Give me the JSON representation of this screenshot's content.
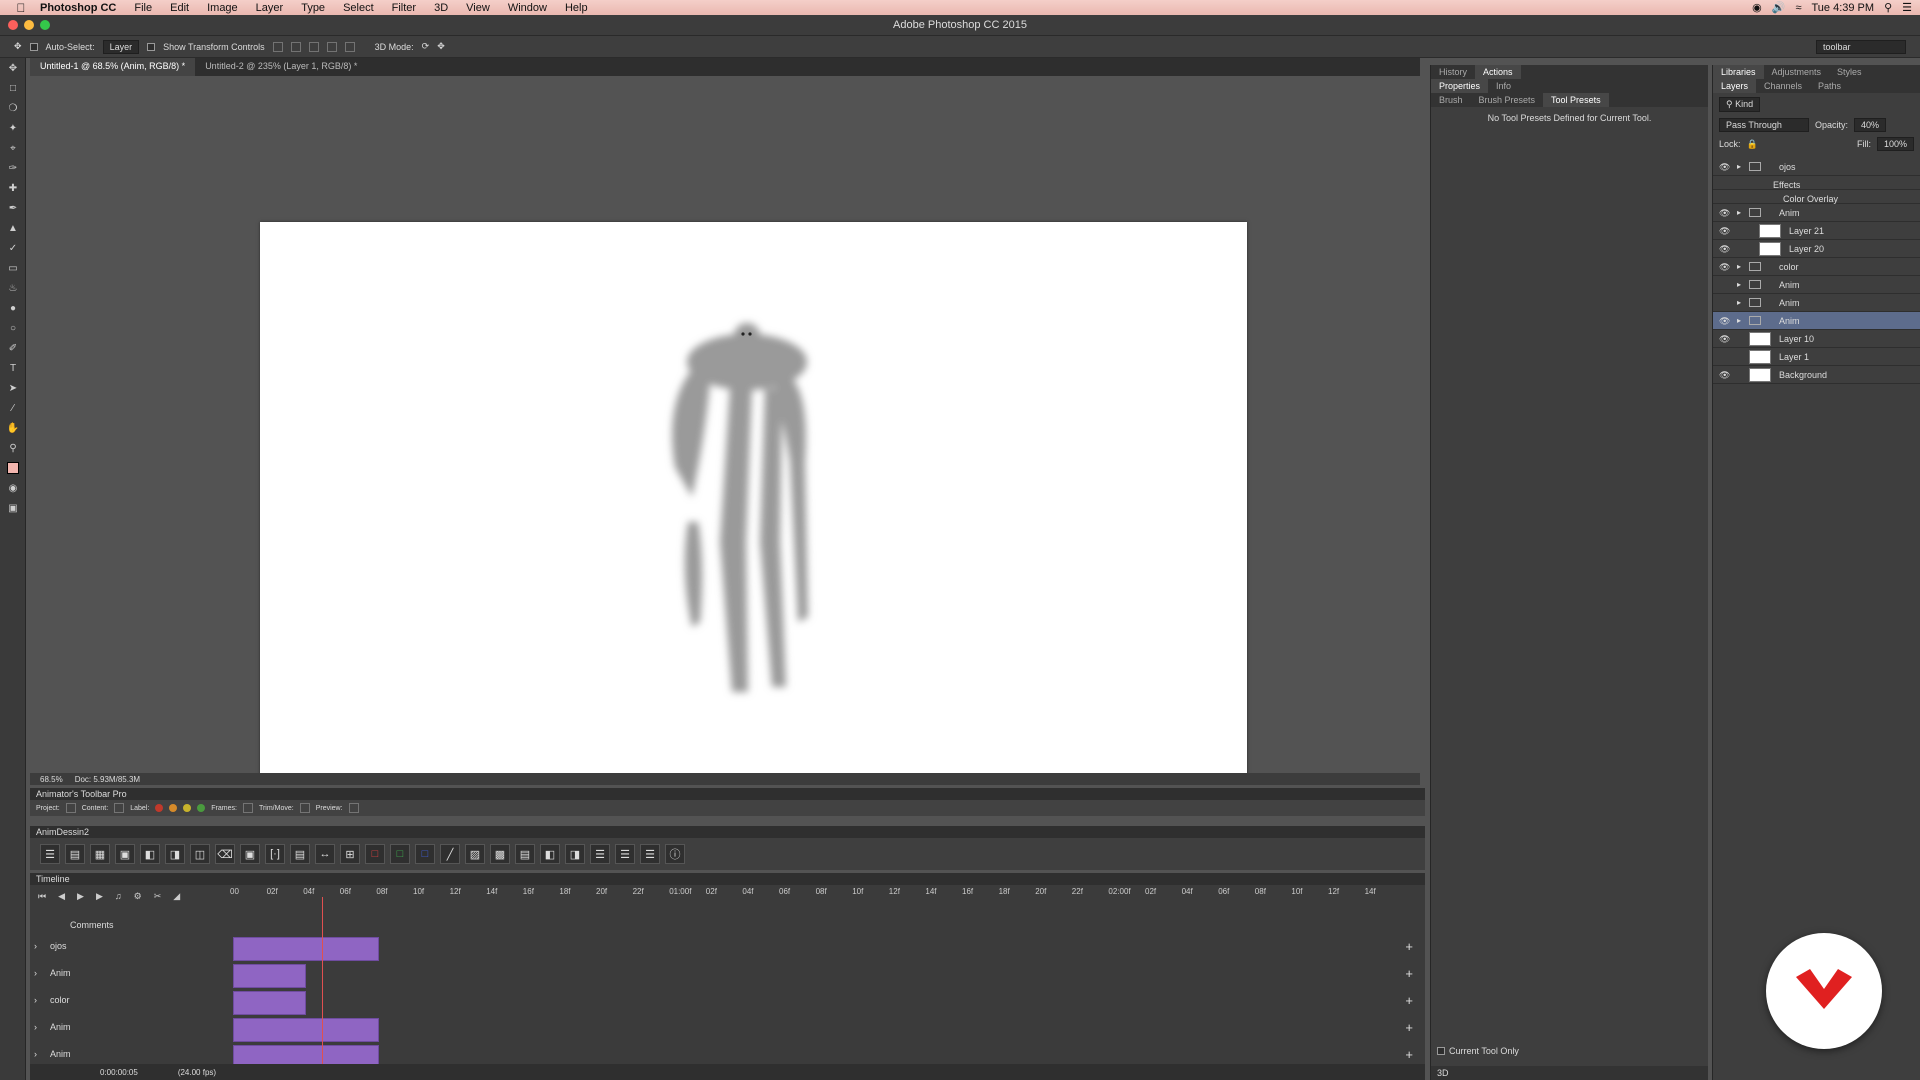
{
  "menubar": {
    "app": "Photoshop CC",
    "items": [
      "File",
      "Edit",
      "Image",
      "Layer",
      "Type",
      "Select",
      "Filter",
      "3D",
      "View",
      "Window",
      "Help"
    ],
    "clock": "Tue 4:39 PM"
  },
  "window": {
    "title": "Adobe Photoshop CC 2015"
  },
  "options": {
    "auto_select": "Auto-Select:",
    "layer_select": "Layer",
    "show_transform": "Show Transform Controls",
    "mode_3d": "3D Mode:",
    "workspace": "toolbar"
  },
  "tabs": [
    "Untitled-1 @ 68.5% (Anim, RGB/8) *",
    "Untitled-2 @ 235% (Layer 1, RGB/8) *"
  ],
  "status": {
    "zoom": "68.5%",
    "doc": "Doc: 5.93M/85.3M"
  },
  "atp": {
    "title": "Animator's Toolbar Pro",
    "project": "Project:",
    "content": "Content:",
    "label": "Label:",
    "frames": "Frames:",
    "trim": "Trim/Move:",
    "preview": "Preview:"
  },
  "anim": {
    "title": "AnimDessin2"
  },
  "timeline": {
    "title": "Timeline",
    "comments": "Comments",
    "time": "0:00:00:05",
    "fps": "(24.00 fps)",
    "playhead_frame": 5,
    "ruler": [
      "00",
      "02f",
      "04f",
      "06f",
      "08f",
      "10f",
      "12f",
      "14f",
      "16f",
      "18f",
      "20f",
      "22f",
      "01:00f",
      "02f",
      "04f",
      "06f",
      "08f",
      "10f",
      "12f",
      "14f",
      "16f",
      "18f",
      "20f",
      "22f",
      "02:00f",
      "02f",
      "04f",
      "06f",
      "08f",
      "10f",
      "12f",
      "14f"
    ],
    "tracks": [
      {
        "name": "ojos",
        "frames": 10
      },
      {
        "name": "Anim",
        "frames": 5
      },
      {
        "name": "color",
        "frames": 5
      },
      {
        "name": "Anim",
        "frames": 10
      },
      {
        "name": "Anim",
        "frames": 10
      }
    ]
  },
  "mid": {
    "tabs_top": [
      "History",
      "Actions"
    ],
    "tabs_props": [
      "Properties",
      "Info"
    ],
    "tabs_tool": [
      "Brush",
      "Brush Presets",
      "Tool Presets"
    ],
    "message": "No Tool Presets Defined for Current Tool.",
    "current_tool_only": "Current Tool Only",
    "bottom": "3D"
  },
  "layers": {
    "tabs_top": [
      "Libraries",
      "Adjustments",
      "Styles"
    ],
    "tabs": [
      "Layers",
      "Channels",
      "Paths"
    ],
    "kind": "Kind",
    "blend": "Pass Through",
    "opacity_label": "Opacity:",
    "opacity": "40%",
    "lock_label": "Lock:",
    "fill_label": "Fill:",
    "fill": "100%",
    "rows": [
      {
        "name": "ojos",
        "kind": "group",
        "eye": true,
        "indent": 0
      },
      {
        "name": "Effects",
        "kind": "fx",
        "eye": false,
        "indent": 1
      },
      {
        "name": "Color Overlay",
        "kind": "fx",
        "eye": false,
        "indent": 2
      },
      {
        "name": "Anim",
        "kind": "group",
        "eye": true,
        "indent": 0
      },
      {
        "name": "Layer 21",
        "kind": "layer",
        "eye": true,
        "indent": 1
      },
      {
        "name": "Layer 20",
        "kind": "layer",
        "eye": true,
        "indent": 1
      },
      {
        "name": "color",
        "kind": "group",
        "eye": true,
        "indent": 0
      },
      {
        "name": "Anim",
        "kind": "group",
        "eye": false,
        "indent": 0
      },
      {
        "name": "Anim",
        "kind": "group",
        "eye": false,
        "indent": 0
      },
      {
        "name": "Anim",
        "kind": "group",
        "eye": true,
        "indent": 0,
        "selected": true
      },
      {
        "name": "Layer 10",
        "kind": "layer",
        "eye": true,
        "indent": 0
      },
      {
        "name": "Layer 1",
        "kind": "layer",
        "eye": false,
        "indent": 0
      },
      {
        "name": "Background",
        "kind": "layer",
        "eye": true,
        "indent": 0
      }
    ]
  },
  "colors": {
    "menubar": "#f0c4bc",
    "clip": "#8f65c3",
    "selected_layer": "#5d6c8c",
    "badge_mark": "#e02020"
  }
}
